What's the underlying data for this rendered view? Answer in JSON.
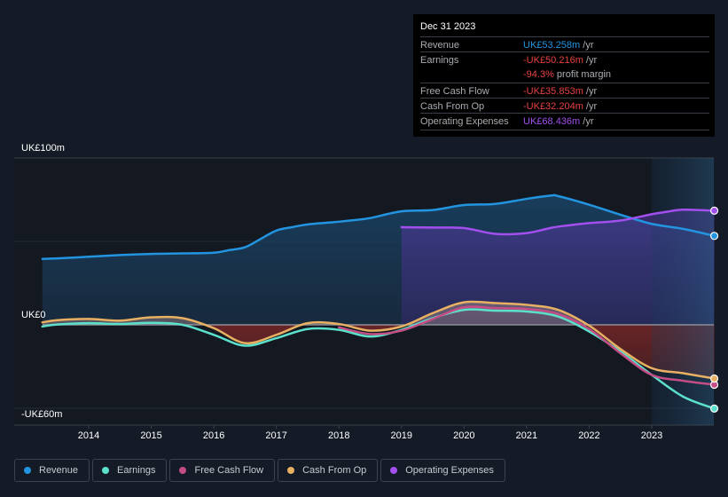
{
  "tooltip": {
    "date": "Dec 31 2023",
    "rows": [
      {
        "label": "Revenue",
        "value": "UK£53.258m",
        "unit": " /yr",
        "color": "#2394df"
      },
      {
        "label": "Earnings",
        "value": "-UK£50.216m",
        "unit": " /yr",
        "color": "#e64141"
      },
      {
        "label": "",
        "value": "-94.3%",
        "unit": " profit margin",
        "color": "#e64141"
      },
      {
        "label": "Free Cash Flow",
        "value": "-UK£35.853m",
        "unit": " /yr",
        "color": "#e64141"
      },
      {
        "label": "Cash From Op",
        "value": "-UK£32.204m",
        "unit": " /yr",
        "color": "#e64141"
      },
      {
        "label": "Operating Expenses",
        "value": "UK£68.436m",
        "unit": " /yr",
        "color": "#a34fee"
      }
    ]
  },
  "legend": [
    {
      "label": "Revenue",
      "color": "#2394df"
    },
    {
      "label": "Earnings",
      "color": "#5ce0cc"
    },
    {
      "label": "Free Cash Flow",
      "color": "#c44d85"
    },
    {
      "label": "Cash From Op",
      "color": "#e8b063"
    },
    {
      "label": "Operating Expenses",
      "color": "#a34fee"
    }
  ],
  "chart_data": {
    "type": "area",
    "title": "",
    "xlabel": "",
    "ylabel": "",
    "y_tick_labels": [
      {
        "value": 100,
        "label": "UK£100m"
      },
      {
        "value": 0,
        "label": "UK£0"
      },
      {
        "value": -60,
        "label": "-UK£60m"
      }
    ],
    "ylim": [
      -60,
      100
    ],
    "xlim": [
      2013.25,
      2024.0
    ],
    "x_ticks": [
      2014,
      2015,
      2016,
      2017,
      2018,
      2019,
      2020,
      2021,
      2022,
      2023
    ],
    "x_tick_labels": [
      "2014",
      "2015",
      "2016",
      "2017",
      "2018",
      "2019",
      "2020",
      "2021",
      "2022",
      "2023"
    ],
    "grid": true,
    "highlight_start": 2023.0,
    "legend_position": "bottom",
    "series": [
      {
        "name": "Revenue",
        "color": "#2394df",
        "x": [
          2013.26,
          2013.5,
          2014.0,
          2014.5,
          2015.0,
          2015.5,
          2016.0,
          2016.25,
          2016.5,
          2016.75,
          2017.0,
          2017.25,
          2017.5,
          2018.0,
          2018.25,
          2018.5,
          2019.0,
          2019.5,
          2020.0,
          2020.5,
          2021.0,
          2021.4,
          2021.5,
          2022.0,
          2022.5,
          2023.0,
          2023.5,
          2024.0
        ],
        "y": [
          39.5,
          39.8,
          40.8,
          41.8,
          42.5,
          42.8,
          43.2,
          44.8,
          46.5,
          51.5,
          56.5,
          58.5,
          60.2,
          61.8,
          62.8,
          64.0,
          68.0,
          68.8,
          71.8,
          72.5,
          75.5,
          77.5,
          77.2,
          72.0,
          66.0,
          60.5,
          57.5,
          53.3
        ]
      },
      {
        "name": "Earnings",
        "color": "#5ce0cc",
        "x": [
          2013.26,
          2013.5,
          2014.0,
          2014.5,
          2015.0,
          2015.5,
          2016.0,
          2016.5,
          2017.0,
          2017.5,
          2018.0,
          2018.5,
          2019.0,
          2019.5,
          2020.0,
          2020.5,
          2021.0,
          2021.5,
          2022.0,
          2022.5,
          2023.0,
          2023.5,
          2024.0
        ],
        "y": [
          -1.0,
          0.2,
          1.0,
          0.5,
          1.2,
          0.0,
          -6.0,
          -12.5,
          -8.0,
          -2.5,
          -3.0,
          -7.0,
          -3.0,
          4.0,
          9.0,
          8.5,
          8.0,
          5.0,
          -4.0,
          -16.0,
          -30.0,
          -43.0,
          -50.2
        ]
      },
      {
        "name": "Free Cash Flow",
        "color": "#c44d85",
        "x": [
          2018.0,
          2018.5,
          2019.0,
          2019.5,
          2020.0,
          2020.5,
          2021.0,
          2021.5,
          2022.0,
          2022.5,
          2023.0,
          2023.5,
          2024.0
        ],
        "y": [
          -1.5,
          -5.5,
          -3.5,
          3.5,
          10.5,
          10.0,
          9.5,
          6.5,
          -2.5,
          -17.0,
          -30.0,
          -33.5,
          -35.9
        ]
      },
      {
        "name": "Cash From Op",
        "color": "#e8b063",
        "x": [
          2013.26,
          2013.5,
          2014.0,
          2014.5,
          2015.0,
          2015.5,
          2016.0,
          2016.5,
          2017.0,
          2017.5,
          2018.0,
          2018.5,
          2019.0,
          2019.5,
          2020.0,
          2020.5,
          2021.0,
          2021.5,
          2022.0,
          2022.5,
          2023.0,
          2023.5,
          2024.0
        ],
        "y": [
          1.5,
          2.8,
          3.5,
          2.5,
          4.5,
          4.0,
          -2.0,
          -11.0,
          -6.0,
          1.0,
          0.5,
          -3.5,
          -1.0,
          7.0,
          13.5,
          13.0,
          12.0,
          9.0,
          -0.5,
          -14.5,
          -26.0,
          -29.0,
          -32.2
        ]
      },
      {
        "name": "Operating Expenses",
        "color": "#a34fee",
        "x": [
          2019.0,
          2019.5,
          2020.0,
          2020.5,
          2021.0,
          2021.4,
          2021.75,
          2022.0,
          2022.5,
          2023.0,
          2023.25,
          2023.5,
          2024.0
        ],
        "y": [
          58.5,
          58.3,
          58.0,
          54.5,
          55.0,
          58.2,
          60.0,
          61.0,
          62.5,
          66.3,
          67.8,
          69.0,
          68.4
        ]
      }
    ]
  }
}
